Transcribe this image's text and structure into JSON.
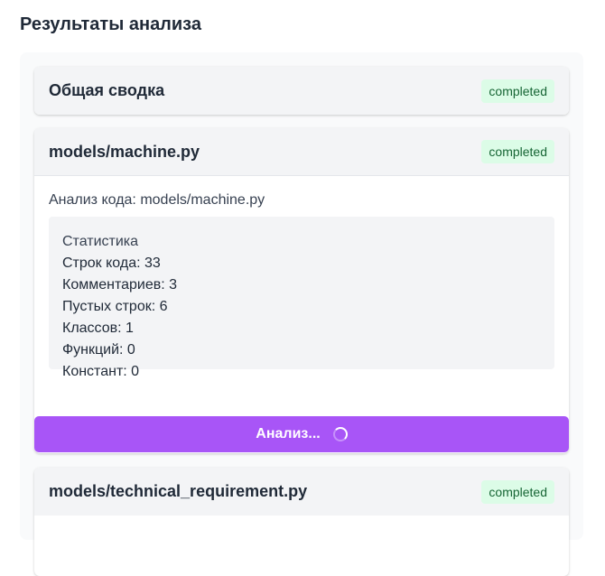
{
  "page": {
    "title": "Результаты анализа"
  },
  "cards": {
    "summary": {
      "title": "Общая сводка",
      "status": "completed"
    },
    "machine": {
      "title": "models/machine.py",
      "status": "completed",
      "analysis_line": "Анализ кода: models/machine.py",
      "stats": {
        "heading": "Статистика",
        "rows": [
          "Строк кода: 33",
          "Комментариев: 3",
          "Пустых строк: 6",
          "Классов: 1",
          "Функций: 0",
          "Констант: 0"
        ]
      }
    },
    "technical_requirement": {
      "title": "models/technical_requirement.py",
      "status": "completed"
    }
  },
  "analyze_button": {
    "label": "Анализ...",
    "icon": "spinner-icon"
  },
  "colors": {
    "accent": "#a855f7",
    "badge_bg": "#dcfce7",
    "badge_text": "#166534",
    "header_bg": "#f3f4f6"
  }
}
